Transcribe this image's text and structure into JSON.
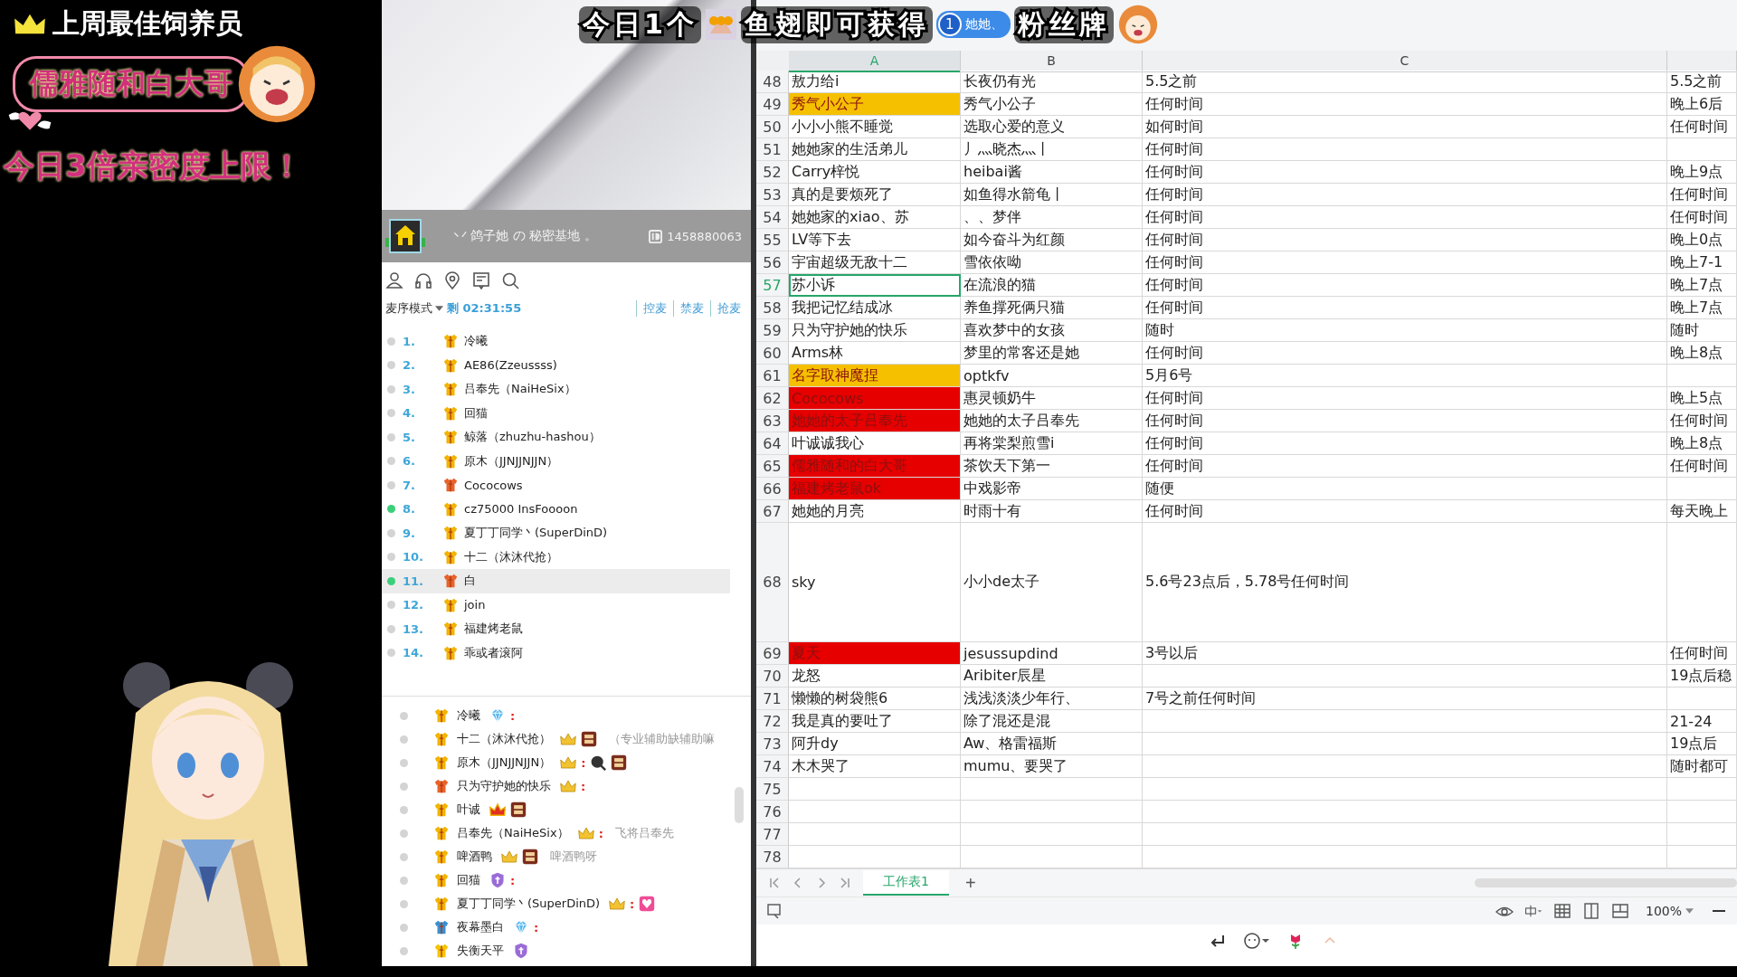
{
  "overlay": {
    "title": "上周最佳饲养员",
    "winner": "儒雅随和白大哥",
    "notice": "今日3倍亲密度上限！"
  },
  "banner": {
    "before": "今日1个",
    "after": "鱼翅即可获得",
    "badge_level": "1",
    "badge_name": "她她、",
    "end": "粉丝牌"
  },
  "room": {
    "name": "丷 鸽子她 の 秘密基地 。",
    "id": "1458880063"
  },
  "mic": {
    "mode": "麦序模式",
    "timer": "剩 02:31:55",
    "actions": [
      "控麦",
      "禁麦",
      "抢麦"
    ]
  },
  "queue": [
    {
      "num": "1.",
      "name": "冷曦",
      "online": false,
      "selected": false,
      "color": "#f2b400"
    },
    {
      "num": "2.",
      "name": "AE86(Zzeussss)",
      "online": false,
      "selected": false,
      "color": "#f2b400"
    },
    {
      "num": "3.",
      "name": "吕奉先（NaiHeSix）",
      "online": false,
      "selected": false,
      "color": "#f2b400"
    },
    {
      "num": "4.",
      "name": "回猫",
      "online": false,
      "selected": false,
      "color": "#f2b400"
    },
    {
      "num": "5.",
      "name": "鲸落（zhuzhu-hashou）",
      "online": false,
      "selected": false,
      "color": "#f2b400"
    },
    {
      "num": "6.",
      "name": "原木（JJNJJNJJN）",
      "online": false,
      "selected": false,
      "color": "#f2b400"
    },
    {
      "num": "7.",
      "name": "Cococows",
      "online": false,
      "selected": false,
      "color": "#e8622a"
    },
    {
      "num": "8.",
      "name": "cz75000 InsFoooon",
      "online": true,
      "selected": false,
      "color": "#f2b400"
    },
    {
      "num": "9.",
      "name": "夏丁丁同学丶(SuperDinD)",
      "online": false,
      "selected": false,
      "color": "#f2b400"
    },
    {
      "num": "10.",
      "name": "十二（沐沐代抢）",
      "online": false,
      "selected": false,
      "color": "#f2b400"
    },
    {
      "num": "11.",
      "name": "白",
      "online": true,
      "selected": true,
      "color": "#e8622a"
    },
    {
      "num": "12.",
      "name": "join",
      "online": false,
      "selected": false,
      "color": "#f2b400"
    },
    {
      "num": "13.",
      "name": "福建烤老鼠",
      "online": false,
      "selected": false,
      "color": "#f2b400"
    },
    {
      "num": "14.",
      "name": "乖或者滚阿",
      "online": false,
      "selected": false,
      "color": "#f2b400"
    }
  ],
  "chat": [
    {
      "name": "冷曦",
      "color": "#f2b400",
      "items": [
        {
          "kind": "diamond"
        },
        {
          "kind": "colon",
          "text": ":"
        }
      ]
    },
    {
      "name": "十二（沐沐代抢）",
      "color": "#f2b400",
      "items": [
        {
          "kind": "crown"
        },
        {
          "kind": "noble"
        }
      ],
      "message": "（专业辅助缺辅助嘛"
    },
    {
      "name": "原木（JJNJJNJJN）",
      "color": "#f2b400",
      "items": [
        {
          "kind": "crown"
        },
        {
          "kind": "colon",
          "text": ":"
        },
        {
          "kind": "pan"
        },
        {
          "kind": "noble"
        }
      ]
    },
    {
      "name": "只为守护她的快乐",
      "color": "#e8622a",
      "items": [
        {
          "kind": "crown"
        },
        {
          "kind": "colon",
          "text": ":"
        }
      ]
    },
    {
      "name": "叶诚",
      "color": "#f2b400",
      "items": [
        {
          "kind": "royal"
        },
        {
          "kind": "noble"
        }
      ]
    },
    {
      "name": "吕奉先（NaiHeSix）",
      "color": "#f2b400",
      "items": [
        {
          "kind": "crown"
        },
        {
          "kind": "colon",
          "text": ":"
        }
      ],
      "message": "飞将吕奉先"
    },
    {
      "name": "啤酒鸭",
      "color": "#f2b400",
      "items": [
        {
          "kind": "crown"
        },
        {
          "kind": "noble"
        }
      ],
      "message": "啤酒鸭呀"
    },
    {
      "name": "回猫",
      "color": "#f2b400",
      "items": [
        {
          "kind": "shield"
        },
        {
          "kind": "colon",
          "text": ":"
        }
      ]
    },
    {
      "name": "夏丁丁同学丶(SuperDinD)",
      "color": "#f2b400",
      "items": [
        {
          "kind": "crown"
        },
        {
          "kind": "colon",
          "text": ":"
        },
        {
          "kind": "heart"
        }
      ]
    },
    {
      "name": "夜幕墨白",
      "color": "#3a8fd0",
      "items": [
        {
          "kind": "diamond"
        },
        {
          "kind": "colon",
          "text": ":"
        }
      ]
    },
    {
      "name": "失衡天平",
      "color": "#f5c400",
      "items": [
        {
          "kind": "shield"
        }
      ]
    }
  ],
  "sheet": {
    "columns": [
      {
        "label": "A",
        "selected": true
      },
      {
        "label": "B",
        "selected": false
      },
      {
        "label": "C",
        "selected": false
      }
    ],
    "rows": [
      {
        "num": "48",
        "kind": "normal",
        "selected": false,
        "cells": {
          "a": "敖力给i",
          "b": "长夜仍有光",
          "c": "5.5之前",
          "d": "5.5之前"
        }
      },
      {
        "num": "49",
        "kind": "normal",
        "selected": false,
        "color": "#f5c000",
        "cells": {
          "a": "秀气小公子",
          "b": "秀气小公子",
          "c": "任何时间",
          "d": "晚上6后"
        }
      },
      {
        "num": "50",
        "kind": "normal",
        "selected": false,
        "cells": {
          "a": "小小小熊不睡觉",
          "b": "选取心爱的意义",
          "c": "如何时间",
          "d": "任何时间"
        }
      },
      {
        "num": "51",
        "kind": "normal",
        "selected": false,
        "cells": {
          "a": "她她家的生活弟儿",
          "b": "丿灬晓杰灬丨",
          "c": "任何时间"
        }
      },
      {
        "num": "52",
        "kind": "normal",
        "selected": false,
        "cells": {
          "a": "Carry梓悦",
          "b": "heibai酱",
          "c": "任何时间",
          "d": "晚上9点"
        }
      },
      {
        "num": "53",
        "kind": "normal",
        "selected": false,
        "cells": {
          "a": "真的是要烦死了",
          "b": "如鱼得水箭龟丨",
          "c": "任何时间",
          "d": "任何时间"
        }
      },
      {
        "num": "54",
        "kind": "normal",
        "selected": false,
        "cells": {
          "a": "她她家的xiao、苏",
          "b": "、、梦伴",
          "c": "任何时间",
          "d": "任何时间"
        }
      },
      {
        "num": "55",
        "kind": "normal",
        "selected": false,
        "cells": {
          "a": "LV等下去",
          "b": "如今奋斗为红颜",
          "c": "任何时间",
          "d": "晚上0点"
        }
      },
      {
        "num": "56",
        "kind": "normal",
        "selected": false,
        "cells": {
          "a": "宇宙超级无敌十二",
          "b": "雪依依呦",
          "c": "任何时间",
          "d": "晚上7-1"
        }
      },
      {
        "num": "57",
        "kind": "normal",
        "selected": true,
        "cells": {
          "a": "苏小诉",
          "b": "在流浪的猫",
          "c": "任何时间",
          "d": "晚上7点"
        }
      },
      {
        "num": "58",
        "kind": "normal",
        "selected": false,
        "cells": {
          "a": "我把记忆结成冰",
          "b": "养鱼撑死俩只猫",
          "c": "任何时间",
          "d": "晚上7点"
        }
      },
      {
        "num": "59",
        "kind": "normal",
        "selected": false,
        "cells": {
          "a": "只为守护她的快乐",
          "b": "喜欢梦中的女孩",
          "c": "随时",
          "d": "随时"
        }
      },
      {
        "num": "60",
        "kind": "normal",
        "selected": false,
        "cells": {
          "a": "Arms林",
          "b": "梦里的常客还是她",
          "c": "任何时间",
          "d": "晚上8点"
        }
      },
      {
        "num": "61",
        "kind": "normal",
        "selected": false,
        "color": "#f5c000",
        "cells": {
          "a": "名字取神魔捏",
          "b": "optkfv",
          "c": "5月6号"
        }
      },
      {
        "num": "62",
        "kind": "normal",
        "selected": false,
        "color": "#e60000",
        "cells": {
          "a": "Cococows",
          "b": "惠灵顿奶牛",
          "c": "任何时间",
          "d": "晚上5点"
        }
      },
      {
        "num": "63",
        "kind": "normal",
        "selected": false,
        "color": "#e60000",
        "cells": {
          "a": "她她的太子吕奉先",
          "b": "她她的太子吕奉先",
          "c": "任何时间",
          "d": "任何时间"
        }
      },
      {
        "num": "64",
        "kind": "normal",
        "selected": false,
        "cells": {
          "a": "叶诚诚我心",
          "b": "再将棠梨煎雪i",
          "c": "任何时间",
          "d": "晚上8点"
        }
      },
      {
        "num": "65",
        "kind": "normal",
        "selected": false,
        "color": "#e60000",
        "cells": {
          "a": "儒雅随和的白大哥",
          "b": "茶饮天下第一",
          "c": "任何时间",
          "d": "任何时间"
        }
      },
      {
        "num": "66",
        "kind": "normal",
        "selected": false,
        "color": "#e60000",
        "cells": {
          "a": "福建烤老鼠ok",
          "b": "中戏影帝",
          "c": "随便"
        }
      },
      {
        "num": "67",
        "kind": "normal",
        "selected": false,
        "cells": {
          "a": "她她的月亮",
          "b": "时雨十有",
          "c": "任何时间",
          "d": "每天晚上"
        }
      },
      {
        "num": "68",
        "kind": "tall",
        "selected": false,
        "cells": {
          "a": "sky",
          "b": "小小de太子",
          "c": "5.6号23点后，5.78号任何时间"
        }
      },
      {
        "num": "69",
        "kind": "normal",
        "selected": false,
        "color": "#e60000",
        "cells": {
          "a": "夏天",
          "b": "jesussupdind",
          "c": "3号以后",
          "d": "任何时间"
        }
      },
      {
        "num": "70",
        "kind": "normal",
        "selected": false,
        "cells": {
          "a": "龙怒",
          "b": "Aribiter辰星",
          "d": "19点后稳"
        }
      },
      {
        "num": "71",
        "kind": "normal",
        "selected": false,
        "cells": {
          "a": "懒懒的树袋熊6",
          "b": "浅浅淡淡少年行、",
          "c": "7号之前任何时间"
        }
      },
      {
        "num": "72",
        "kind": "normal",
        "selected": false,
        "cells": {
          "a": "我是真的要吐了",
          "b": "除了混还是混",
          "d": "21-24"
        }
      },
      {
        "num": "73",
        "kind": "normal",
        "selected": false,
        "cells": {
          "a": "阿升dy",
          "b": "Aw、格雷福斯",
          "d": "19点后"
        }
      },
      {
        "num": "74",
        "kind": "normal",
        "selected": false,
        "cells": {
          "a": "木木哭了",
          "b": "mumu、要哭了",
          "d": "随时都可"
        }
      },
      {
        "num": "75",
        "kind": "normal",
        "selected": false,
        "cells": {}
      },
      {
        "num": "76",
        "kind": "normal",
        "selected": false,
        "cells": {}
      },
      {
        "num": "77",
        "kind": "normal",
        "selected": false,
        "cells": {}
      },
      {
        "num": "78",
        "kind": "normal",
        "selected": false,
        "cells": {}
      }
    ],
    "tabs": [
      {
        "label": "工作表1",
        "selected": true
      }
    ],
    "add_tab": "+",
    "zoom": "100%"
  }
}
